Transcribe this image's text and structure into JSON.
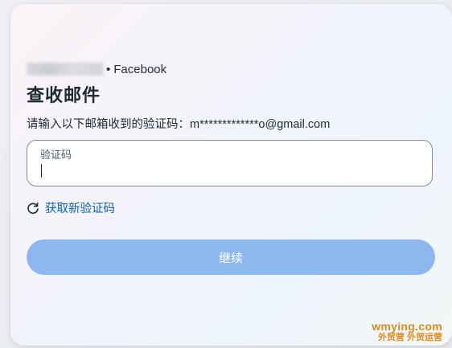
{
  "account": {
    "service": "Facebook",
    "separator": "•"
  },
  "title": "查收邮件",
  "instruction": "请输入以下邮箱收到的验证码：m*************o@gmail.com",
  "code_input": {
    "label": "验证码",
    "value": ""
  },
  "resend": {
    "label": "获取新验证码",
    "icon": "refresh-icon"
  },
  "continue_button": {
    "label": "继续"
  },
  "watermark": {
    "line1": "wmying.com",
    "line2": "外贸营 外贸运营"
  },
  "colors": {
    "link": "#0a5fb4",
    "button_disabled": "#8cb8ef",
    "watermark": "#e08a1e"
  }
}
